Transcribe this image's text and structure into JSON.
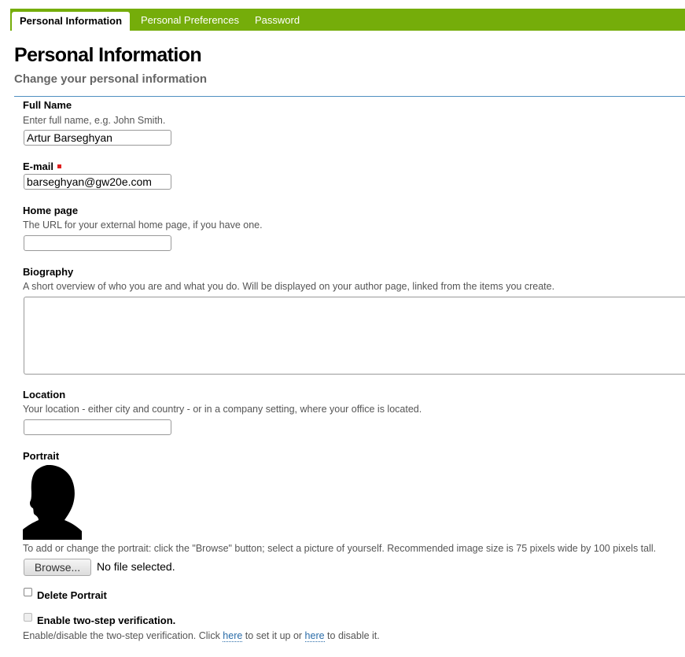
{
  "tabs": [
    {
      "label": "Personal Information",
      "active": true
    },
    {
      "label": "Personal Preferences",
      "active": false
    },
    {
      "label": "Password",
      "active": false
    }
  ],
  "page": {
    "title": "Personal Information",
    "subtitle": "Change your personal information"
  },
  "fields": {
    "full_name": {
      "label": "Full Name",
      "help": "Enter full name, e.g. John Smith.",
      "value": "Artur Barseghyan"
    },
    "email": {
      "label": "E-mail",
      "required": true,
      "value": "barseghyan@gw20e.com"
    },
    "home_page": {
      "label": "Home page",
      "help": "The URL for your external home page, if you have one.",
      "value": ""
    },
    "biography": {
      "label": "Biography",
      "help": "A short overview of who you are and what you do. Will be displayed on your author page, linked from the items you create.",
      "value": ""
    },
    "location": {
      "label": "Location",
      "help": "Your location - either city and country - or in a company setting, where your office is located.",
      "value": ""
    },
    "portrait": {
      "label": "Portrait",
      "image_icon": "default-user-silhouette",
      "help": "To add or change the portrait: click the \"Browse\" button; select a picture of yourself. Recommended image size is 75 pixels wide by 100 pixels tall.",
      "browse_label": "Browse...",
      "file_status": "No file selected."
    },
    "delete_portrait": {
      "label": "Delete Portrait",
      "checked": false
    },
    "two_step": {
      "label": "Enable two-step verification.",
      "checked": false,
      "disabled": true,
      "help_part1": "Enable/disable the two-step verification. Click ",
      "link1": "here",
      "help_part2": " to set it up or ",
      "link2": "here",
      "help_part3": " to disable it."
    }
  },
  "colors": {
    "tab_bar": "#75ad0a",
    "rule": "#4f8fc0",
    "required_marker": "#e02020",
    "link": "#2a6ca8"
  }
}
